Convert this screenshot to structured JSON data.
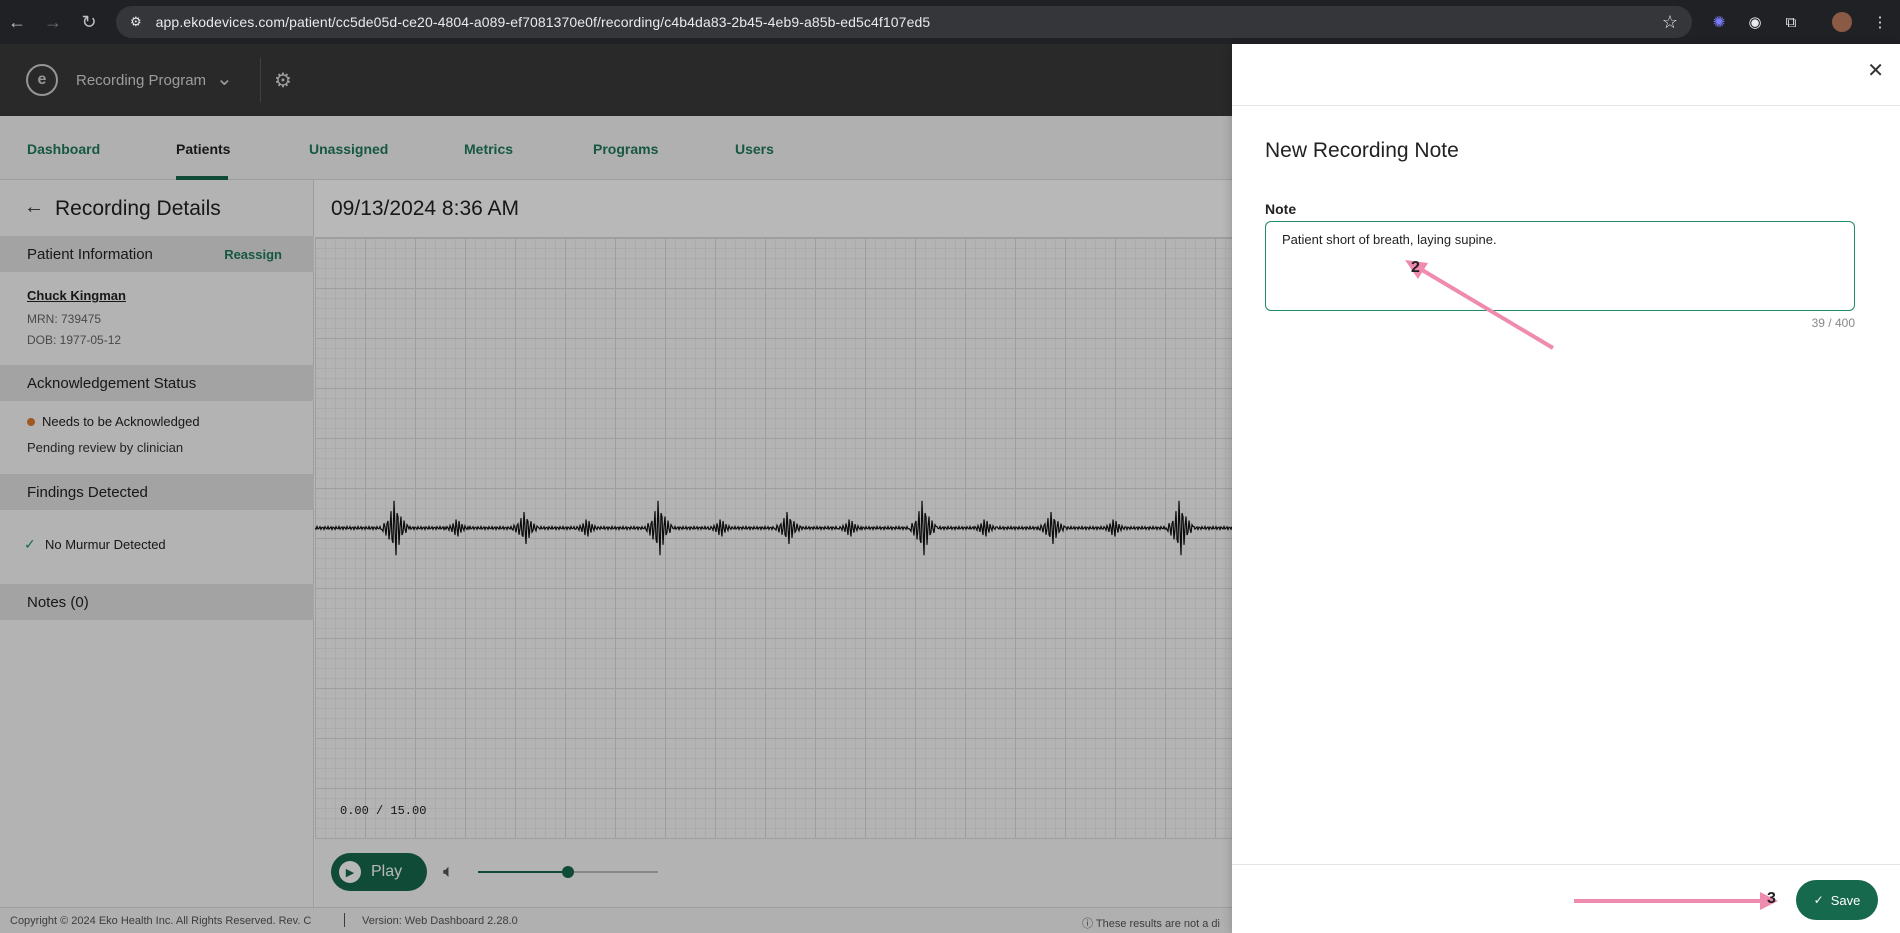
{
  "browser": {
    "url": "app.ekodevices.com/patient/cc5de05d-ce20-4804-a089-ef7081370e0f/recording/c4b4da83-2b45-4eb9-a85b-ed5c4f107ed5"
  },
  "header": {
    "program_name": "Recording Program"
  },
  "nav": {
    "tabs": [
      {
        "label": "Dashboard"
      },
      {
        "label": "Patients",
        "active": true
      },
      {
        "label": "Unassigned"
      },
      {
        "label": "Metrics"
      },
      {
        "label": "Programs"
      },
      {
        "label": "Users"
      }
    ]
  },
  "details": {
    "title": "Recording Details",
    "patient_section": "Patient Information",
    "reassign_label": "Reassign",
    "patient_name": "Chuck Kingman",
    "mrn": "MRN: 739475",
    "dob": "DOB: 1977-05-12",
    "ack_section": "Acknowledgement Status",
    "ack_status": "Needs to be Acknowledged",
    "ack_status_color": "#e07a2c",
    "pending": "Pending review by clinician",
    "findings_section": "Findings Detected",
    "finding": "No Murmur Detected",
    "notes_section": "Notes (0)"
  },
  "recording": {
    "date": "09/13/2024 8:36 AM",
    "time_readout": "0.00 / 15.00",
    "play_label": "Play",
    "volume_level": 0.5
  },
  "footer": {
    "copyright": "Copyright © 2024 Eko Health Inc. All Rights Reserved. Rev. C",
    "version": "Version: Web Dashboard 2.28.0",
    "disclaimer": "These results are not a di"
  },
  "drawer": {
    "title": "New Recording Note",
    "note_label": "Note",
    "note_value": "Patient short of breath, laying supine.",
    "char_count": "39 / 400",
    "save_label": "Save"
  },
  "annotations": {
    "step_2": "2",
    "step_3": "3",
    "arrow_color": "#f08bb0"
  },
  "colors": {
    "accent": "#16694d",
    "header_bg": "#3a3a3a"
  }
}
